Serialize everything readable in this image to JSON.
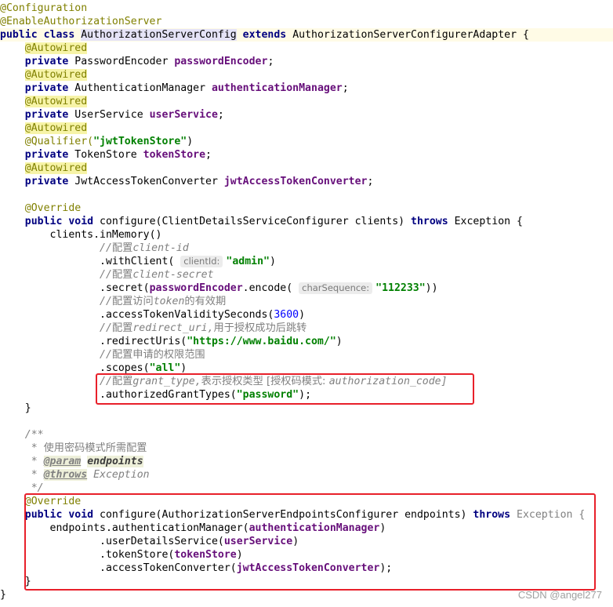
{
  "code": {
    "l1_ann": "@Configuration",
    "l2_ann": "@EnableAuthorizationServer",
    "l3_kw1": "public class ",
    "l3_cls": "AuthorizationServerConfig",
    "l3_kw2": " extends ",
    "l3_rest": "AuthorizationServerConfigurerAdapter {",
    "autowired": "@Autowired",
    "private": "private ",
    "l5_type": "PasswordEncoder ",
    "l5_field": "passwordEncoder",
    "l7_type": "AuthenticationManager ",
    "l7_field": "authenticationManager",
    "l9_type": "UserService ",
    "l9_field": "userService",
    "l11_ann": "@Qualifier(",
    "l11_str": "\"jwtTokenStore\"",
    "l11_end": ")",
    "l12_type": "TokenStore ",
    "l12_field": "tokenStore",
    "l14_type": "JwtAccessTokenConverter ",
    "l14_field": "jwtAccessTokenConverter",
    "semicolon": ";",
    "override": "@Override",
    "l17_kw": "public void ",
    "l17_sig": "configure(ClientDetailsServiceConfigurer clients) ",
    "throws": "throws",
    "l17_exc": " Exception {",
    "l18": "clients.inMemory()",
    "c1_prefix": "//",
    "c1_cn": "配置",
    "c1_rest": "client-id",
    "l20_a": ".withClient( ",
    "l20_hint": "clientId:",
    "l20_str": "\"admin\"",
    "l20_end": ")",
    "c2_rest": "client-secret",
    "l22_a": ".secret(",
    "l22_field": "passwordEncoder",
    "l22_b": ".encode( ",
    "l22_hint": "charSequence:",
    "l22_str": "\"112233\"",
    "l22_end": "))",
    "c3_cn": "配置访问",
    "c3_mid": "token",
    "c3_cn2": "的有效期",
    "l24_a": ".accessTokenValiditySeconds(",
    "l24_num": "3600",
    "l24_end": ")",
    "c4_cn": "配置",
    "c4_mid": "redirect_uri,",
    "c4_cn2": "用于授权成功后跳转",
    "l26_a": ".redirectUris(",
    "l26_str": "\"https://www.baidu.com/\"",
    "l26_end": ")",
    "c5_cn": "配置申请的权限范围",
    "l28_a": ".scopes(",
    "l28_str": "\"all\"",
    "l28_end": ")",
    "c6_cn": "配置",
    "c6_mid": "grant_type,",
    "c6_cn2": "表示授权类型 [授权码模式: ",
    "c6_rest": "authorization_code]",
    "l30_a": ".authorizedGrantTypes(",
    "l30_str": "\"password\"",
    "l30_end": ");",
    "close_brace": "}",
    "doc_open": "/**",
    "doc_star": " * ",
    "doc_cn": "使用密码模式所需配置",
    "doc_param_tag": "@param",
    "doc_param_name": "endpoints",
    "doc_throws_tag": "@throws",
    "doc_throws_name": " Exception",
    "doc_close": " */",
    "l40_sig": "configure(AuthorizationServerEndpointsConfigurer endpoints) ",
    "l40_exc": " Exception {",
    "l41_a": "endpoints.authenticationManager(",
    "l41_field": "authenticationManager",
    "l41_end": ")",
    "l42_a": ".userDetailsService(",
    "l42_field": "userService",
    "l42_end": ")",
    "l43_a": ".tokenStore(",
    "l43_field": "tokenStore",
    "l43_end": ")",
    "l44_a": ".accessTokenConverter(",
    "l44_field": "jwtAccessTokenConverter",
    "l44_end": ");"
  },
  "watermark": "CSDN @angel277",
  "colors": {
    "keyword": "#000080",
    "annotation": "#808000",
    "field": "#660e7a",
    "string": "#008000",
    "comment": "#808080",
    "highlight_box": "#e8202a"
  }
}
